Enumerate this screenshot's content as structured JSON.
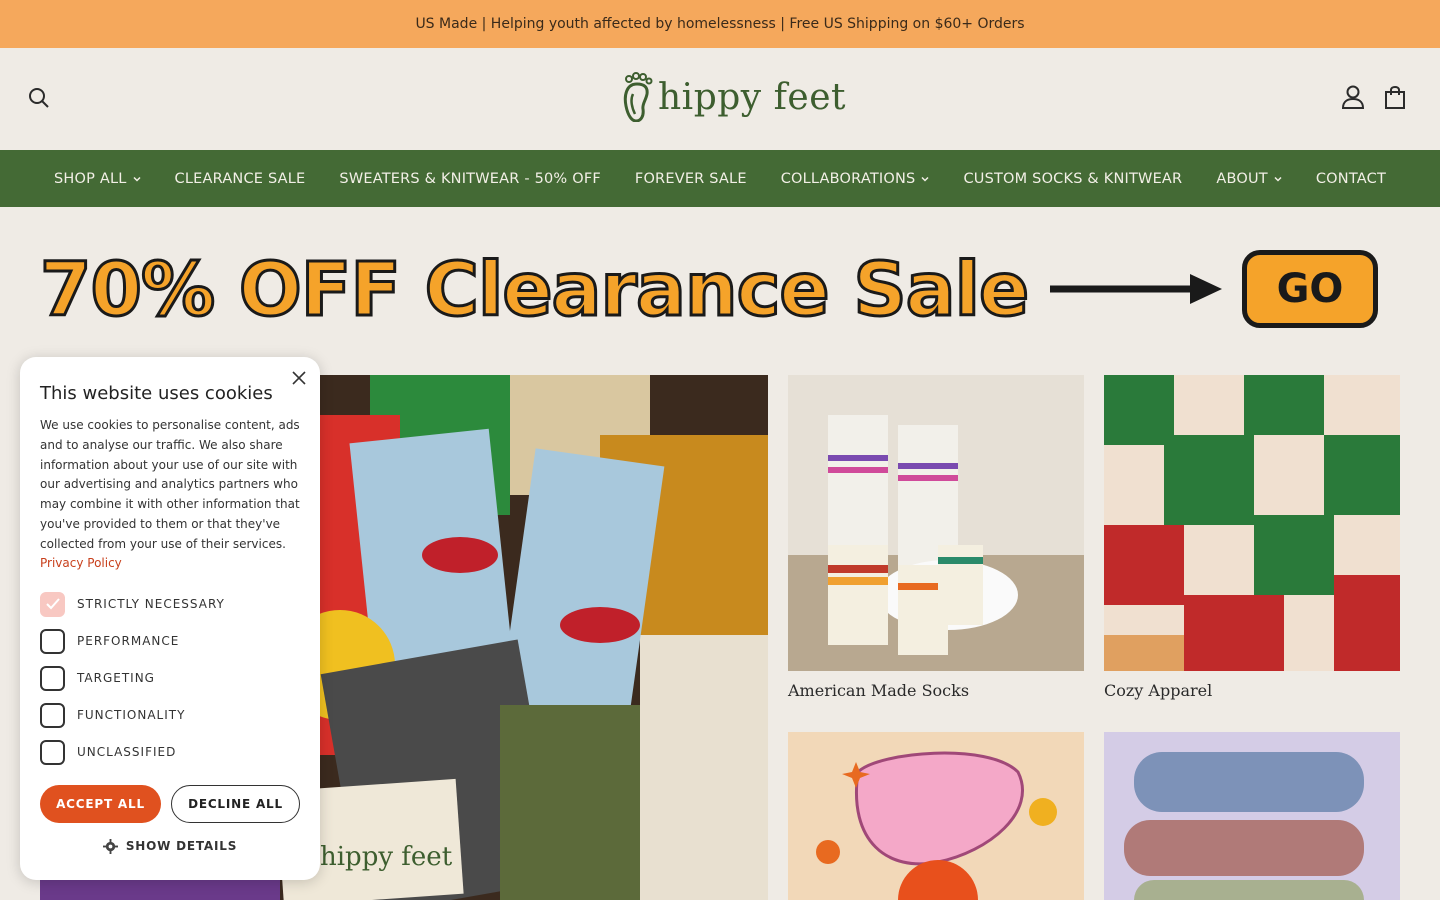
{
  "announcement": "US Made | Helping youth affected by homelessness | Free US Shipping on $60+ Orders",
  "brand": {
    "name": "hippy feet",
    "color": "#3d5e2f"
  },
  "header": {
    "search_icon": "search-icon",
    "account_icon": "account-icon",
    "cart_icon": "cart-icon"
  },
  "nav": {
    "items": [
      {
        "label": "SHOP ALL",
        "has_dropdown": true
      },
      {
        "label": "CLEARANCE SALE",
        "has_dropdown": false
      },
      {
        "label": "SWEATERS & KNITWEAR - 50% OFF",
        "has_dropdown": false
      },
      {
        "label": "FOREVER SALE",
        "has_dropdown": false
      },
      {
        "label": "COLLABORATIONS",
        "has_dropdown": true
      },
      {
        "label": "CUSTOM SOCKS & KNITWEAR",
        "has_dropdown": false
      },
      {
        "label": "ABOUT",
        "has_dropdown": true
      },
      {
        "label": "CONTACT",
        "has_dropdown": false
      }
    ]
  },
  "banner": {
    "text": "70% OFF Clearance Sale",
    "button": "GO"
  },
  "tiles": [
    {
      "label": "American Made Socks"
    },
    {
      "label": "Cozy Apparel"
    }
  ],
  "cookie": {
    "title": "This website uses cookies",
    "body": "We use cookies to personalise content, ads and to analyse our traffic. We also share information about your use of our site with our advertising and analytics partners who may combine it with other information that you've provided to them or that they've collected from your use of their services.",
    "privacy_link": "Privacy Policy",
    "options": [
      {
        "label": "STRICTLY NECESSARY",
        "checked": true
      },
      {
        "label": "PERFORMANCE",
        "checked": false
      },
      {
        "label": "TARGETING",
        "checked": false
      },
      {
        "label": "FUNCTIONALITY",
        "checked": false
      },
      {
        "label": "UNCLASSIFIED",
        "checked": false
      }
    ],
    "accept": "ACCEPT ALL",
    "decline": "DECLINE ALL",
    "details": "SHOW DETAILS"
  },
  "colors": {
    "announce_bg": "#f5a85c",
    "nav_bg": "#446a35",
    "page_bg": "#efebe5",
    "accent": "#e0511f",
    "banner_orange": "#f5a32a"
  }
}
